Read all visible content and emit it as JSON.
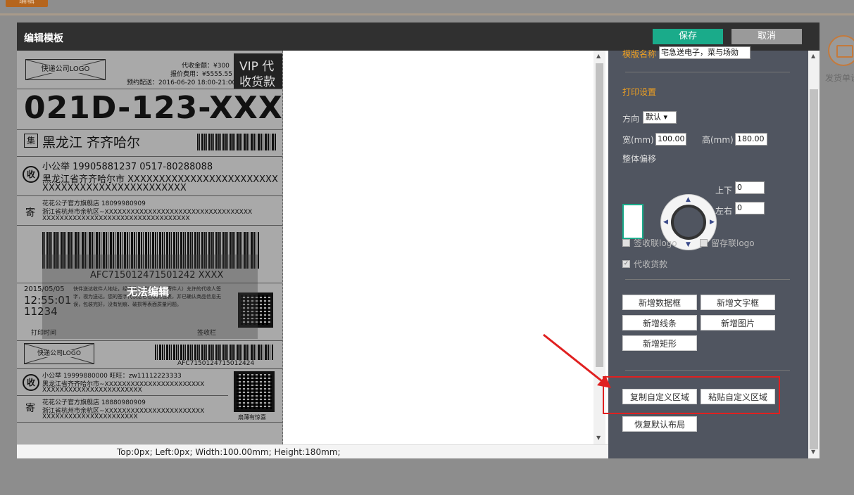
{
  "background": {
    "top_button": "编辑",
    "side_label": "发货单设"
  },
  "modal": {
    "title": "编辑模板",
    "save": "保存",
    "cancel": "取消"
  },
  "status_bar": "Top:0px;  Left:0px;  Width:100.00mm;  Height:180mm;",
  "label": {
    "logo": "快递公司LOGO",
    "cod_amount": "代收金额：¥300",
    "fee": "报价费用：¥5555.55",
    "scheduled": "预约配送：2016-06-20 18:00-21:00",
    "vip": "VIP 代",
    "cod": "收货款",
    "code": "021D-123-XXX",
    "ji_icon": "集",
    "route": "黑龙江 齐齐哈尔",
    "shou_icon": "收",
    "receiver": "小公举   19905881237   0517-80288088",
    "receiver_addr1": "黑龙江省齐齐哈尔市 XXXXXXXXXXXXXXXXXXXXXXXX",
    "receiver_addr2": "XXXXXXXXXXXXXXXXXXXXXXX",
    "ji_sender": "寄",
    "sender": "花花公子官方旗舰店   18099980909",
    "sender_addr1": "浙江省杭州市余杭区~XXXXXXXXXXXXXXXXXXXXXXXXXXXXXXXXXX",
    "sender_addr2": "XXXXXXXXXXXXXXXXXXXXXXXXXXXXXXXXXX",
    "barcode_no": "AFC715012471501242 XXXX",
    "date": "2015/05/05",
    "time": "12:55:01",
    "num": "11234",
    "notice": "快件送达收件人地址，经收件人或收件人（寄件人）允许的代收人签字，视为送达。您的签字代表您已验收此包裹，并已确认商品信息无误，包装完好，没有划痕、破损等表面质量问题。",
    "print_time": "打印时间",
    "sign": "签收栏",
    "no_edit": "无法编辑",
    "logo2": "快递公司LOGO",
    "barcode_no2": "AFC7150124715012424",
    "receiver2": "小公举   19999880000   旺旺：zw11112223333",
    "receiver2_addr1": "黑龙江省齐齐哈尔市~XXXXXXXXXXXXXXXXXXXXXXX",
    "receiver2_addr2": "XXXXXXXXXXXXXXXXXXXXXXX",
    "sender2": "花花公子官方旗舰店   18880980909",
    "sender2_addr1": "浙江省杭州市余杭区~XXXXXXXXXXXXXXXXXXXXXXX",
    "sender2_addr2": "XXXXXXXXXXXXXXXXXXXXXX",
    "slogan": "扇薄有惊喜"
  },
  "panel": {
    "template_name_label": "模版名称",
    "template_name_value": "宅急送电子，菜与场勋",
    "print_settings": "打印设置",
    "direction_label": "方向",
    "direction_value": "默认 ▾",
    "width_label": "宽(mm)",
    "width_value": "100.00",
    "height_label": "高(mm)",
    "height_value": "180.00",
    "offset_label": "整体偏移",
    "updown_label": "上下",
    "updown_value": "0",
    "leftright_label": "左右",
    "leftright_value": "0",
    "sign_logo": "签收联logo",
    "keep_logo": "留存联logo",
    "cod_check": "代收货款",
    "add_data_box": "新增数据框",
    "add_text_box": "新增文字框",
    "add_line": "新增线条",
    "add_image": "新增图片",
    "add_rect": "新增矩形",
    "copy_region": "复制自定义区域",
    "paste_region": "粘贴自定义区域",
    "restore_layout": "恢复默认布局"
  },
  "colors": {
    "save": "#1aab8a",
    "panel": "#505560",
    "highlight": "#e02020",
    "section": "#f0a020"
  }
}
